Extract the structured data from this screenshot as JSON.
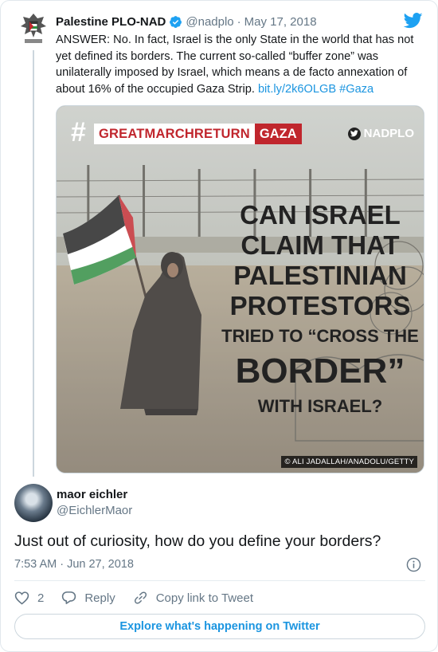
{
  "parent_tweet": {
    "display_name": "Palestine PLO-NAD",
    "handle": "@nadplo",
    "separator": "·",
    "date": "May 17, 2018",
    "text": "ANSWER: No. In fact, Israel is the only State in the world that has not yet defined its borders. The current so-called “buffer zone” was unilaterally imposed by Israel, which means a de facto annexation of about 16% of the occupied Gaza Strip. ",
    "link": "bit.ly/2k6OLGB",
    "hashtag": "#Gaza",
    "media": {
      "hash_symbol": "#",
      "banner_left": "GREATMARCHRETURN",
      "banner_right": "GAZA",
      "brand": "NADPLO",
      "headline": [
        "CAN ISRAEL",
        "CLAIM THAT",
        "PALESTINIAN",
        "PROTESTORS",
        "TRIED TO “CROSS THE",
        "BORDER”",
        "WITH ISRAEL?"
      ],
      "credit": "© ALI JADALLAH/ANADOLU/GETTY"
    }
  },
  "reply_tweet": {
    "display_name": "maor eichler",
    "handle": "@EichlerMaor",
    "text": "Just out of curiosity, how do you define your borders?",
    "timestamp": "7:53 AM · Jun 27, 2018",
    "like_count": "2",
    "reply_label": "Reply",
    "copy_link_label": "Copy link to Tweet"
  },
  "explore_label": "Explore what's happening on Twitter",
  "colors": {
    "link": "#1b95e0",
    "verified": "#1da1f2",
    "banner_red": "#c0262d"
  }
}
